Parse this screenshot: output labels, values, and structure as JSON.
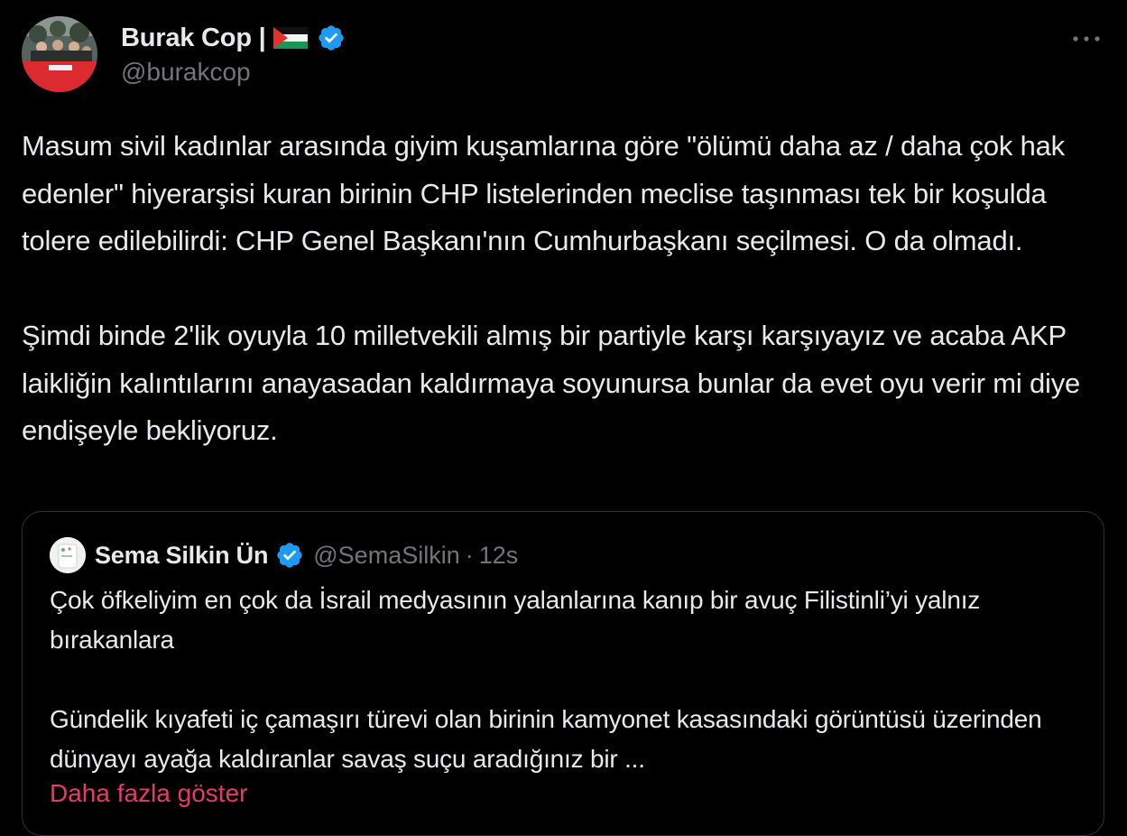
{
  "tweet": {
    "author": {
      "display_name": "Burak Cop |",
      "handle": "@burakcop",
      "verified": true,
      "flag_icon": "palestine-flag-icon"
    },
    "menu_icon": "more-dots-icon",
    "text": "Masum sivil kadınlar arasında giyim kuşamlarına göre \"ölümü daha az / daha çok hak edenler\" hiyerarşisi kuran birinin CHP listelerinden meclise taşınması tek bir koşulda tolere edilebilirdi: CHP Genel Başkanı'nın Cumhurbaşkanı seçilmesi. O da olmadı.\n\nŞimdi binde 2'lik oyuyla 10 milletvekili almış bir partiyle karşı karşıyayız ve acaba AKP laikliğin kalıntılarını anayasadan kaldırmaya soyunursa bunlar da evet oyu verir mi diye endişeyle bekliyoruz."
  },
  "quoted_tweet": {
    "author": {
      "display_name": "Sema Silkin Ün",
      "handle": "@SemaSilkin",
      "verified": true
    },
    "separator": "·",
    "time": "12s",
    "text": "Çok öfkeliyim en çok da İsrail medyasının yalanlarına kanıp bir avuç Filistinli’yi yalnız bırakanlara\n\nGündelik kıyafeti iç çamaşırı türevi olan birinin kamyonet kasasındaki görüntüsü üzerinden dünyayı ayağa kaldıranlar savaş suçu aradığınız bir ...",
    "show_more_label": "Daha fazla göster"
  },
  "colors": {
    "background": "#000000",
    "text_primary": "#e7e9ea",
    "text_secondary": "#71767b",
    "verified_blue": "#1d9bf0",
    "show_more_pink": "#e8386f",
    "border": "#2f3336"
  }
}
